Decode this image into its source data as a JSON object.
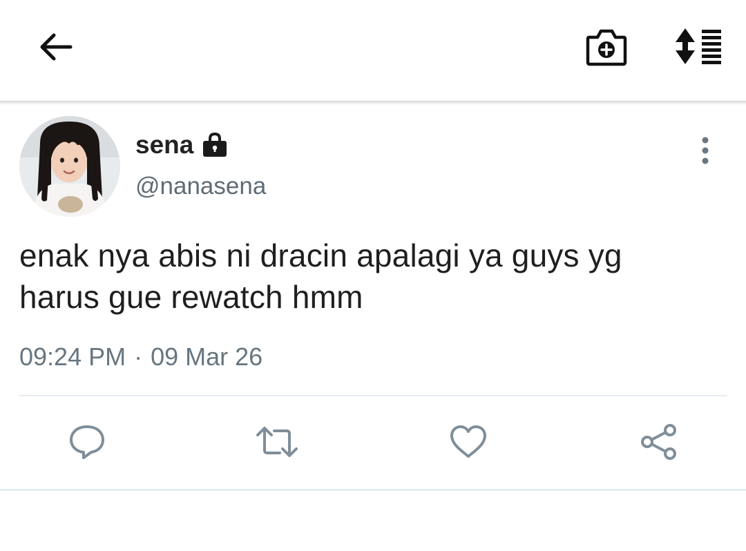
{
  "toolbar": {
    "back_icon": "arrow-left-icon",
    "camera_icon": "camera-plus-icon",
    "sort_icon": "sort-list-icon"
  },
  "tweet": {
    "display_name": "sena",
    "protected_icon": "lock-icon",
    "handle": "@nanasena",
    "more_icon": "vertical-dots-icon",
    "text_line_1": "enak nya abis ni dracin apalagi ya guys yg",
    "text_line_2": "harus gue rewatch hmm",
    "time": "09:24 PM",
    "separator": "·",
    "date": "09 Mar 26"
  },
  "actions": {
    "reply_icon": "reply-bubble-icon",
    "retweet_icon": "retweet-icon",
    "like_icon": "heart-icon",
    "share_icon": "share-icon",
    "icon_color": "#7f8e99"
  },
  "colors": {
    "text": "#1f1f1f",
    "secondary": "#66757f",
    "divider": "#e6ecf0"
  }
}
